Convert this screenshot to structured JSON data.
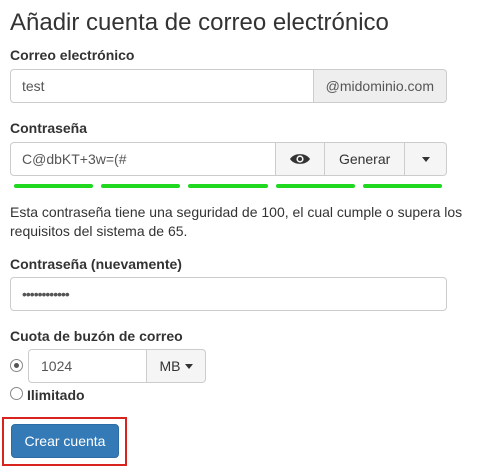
{
  "page": {
    "title": "Añadir cuenta de correo electrónico"
  },
  "email": {
    "label": "Correo electrónico",
    "value": "test",
    "domain": "@midominio.com"
  },
  "password": {
    "label": "Contraseña",
    "value": "C@dbKT+3w=(#",
    "show_icon": "eye-icon",
    "generate_label": "Generar",
    "dropdown_icon": "caret-down-icon",
    "strength_color": "#1fd81f",
    "strength_segments": 5,
    "help_text": "Esta contraseña tiene una seguridad de 100, el cual cumple o supera los requisitos del sistema de 65."
  },
  "password_confirm": {
    "label": "Contraseña (nuevamente)",
    "value": "••••••••••••"
  },
  "quota": {
    "label": "Cuota de buzón de correo",
    "value": "1024",
    "unit": "MB",
    "unlimited_label": "Ilimitado",
    "selected": "limited"
  },
  "actions": {
    "create_label": "Crear cuenta",
    "primary_color": "#337ab7",
    "highlight_color": "#d9231f"
  }
}
